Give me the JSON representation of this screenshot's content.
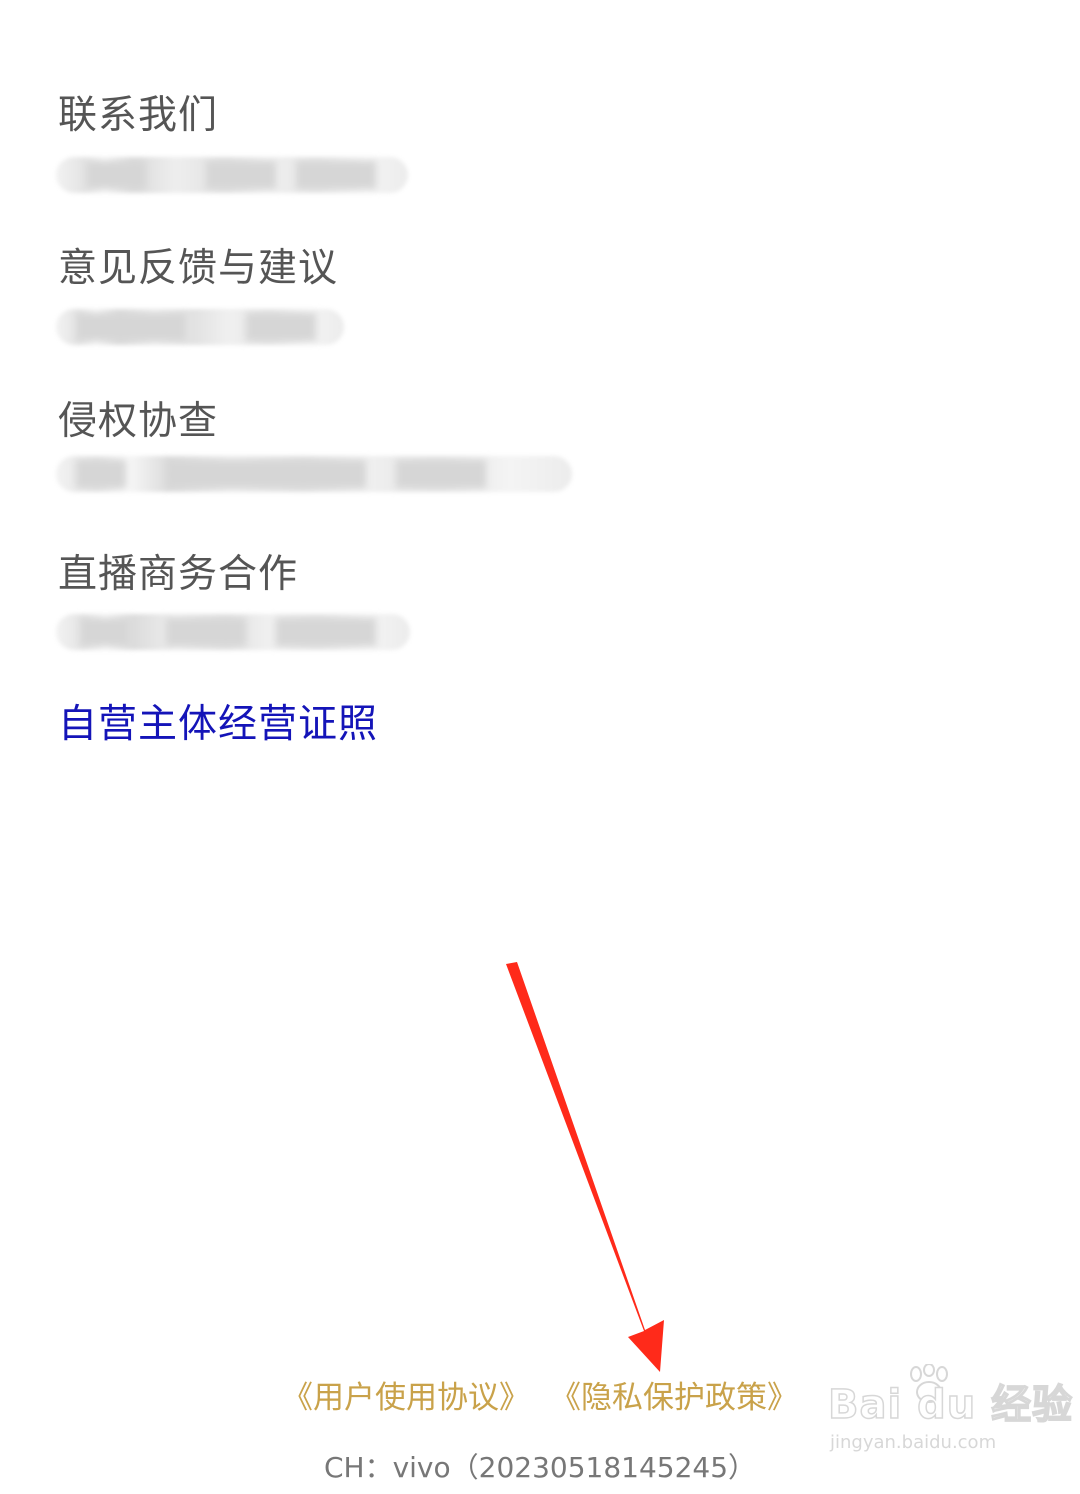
{
  "sections": [
    {
      "title": "联系我们"
    },
    {
      "title": "意见反馈与建议"
    },
    {
      "title": "侵权协查"
    },
    {
      "title": "直播商务合作"
    }
  ],
  "license_link": "自营主体经营证照",
  "footer": {
    "user_agreement": "《用户使用协议》",
    "privacy_policy": "《隐私保护政策》",
    "channel": "CH：vivo（20230518145245）"
  },
  "watermark": {
    "logo": "Bai du 经验",
    "url": "jingyan.baidu.com"
  },
  "colors": {
    "section_title": "#555555",
    "link_blue": "#1414b8",
    "footer_gold": "#c9a24a",
    "annotation_arrow": "#ff2a1a"
  }
}
